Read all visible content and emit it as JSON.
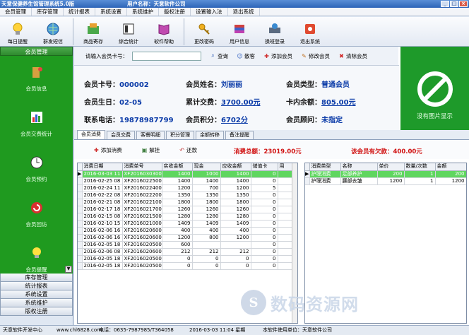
{
  "window": {
    "app_title": "天意保健养生馆管理系统5.0版",
    "user_label": "用户名称：天意软件公司",
    "buttons": [
      "_",
      "□",
      "×"
    ]
  },
  "menu": [
    "会员管理",
    "库存管理",
    "统计报表",
    "系统设置",
    "系统维护",
    "版权注册",
    "设置输入法",
    "退出系统"
  ],
  "toolbar": [
    {
      "label": "每日提醒",
      "icon": "lightbulb-icon"
    },
    {
      "label": "群发短信",
      "icon": "globe-icon"
    },
    {
      "label": "商品寄存",
      "icon": "storage-icon"
    },
    {
      "label": "综合统计",
      "icon": "book-icon"
    },
    {
      "label": "软件帮助",
      "icon": "help-book-icon"
    },
    {
      "label": "更改密码",
      "icon": "key-icon"
    },
    {
      "label": "用户信息",
      "icon": "books-icon"
    },
    {
      "label": "换班登录",
      "icon": "login-icon"
    },
    {
      "label": "退出系统",
      "icon": "exit-icon"
    }
  ],
  "sidebar": {
    "header": "会员管理",
    "items": [
      {
        "label": "会员信息",
        "icon": "member-info-icon"
      },
      {
        "label": "会员交费统计",
        "icon": "chart-icon"
      },
      {
        "label": "会员预约",
        "icon": "clock-icon"
      },
      {
        "label": "会员回访",
        "icon": "refresh-icon"
      },
      {
        "label": "会员提醒",
        "icon": "bulb-icon"
      }
    ],
    "groups": [
      "库存管理",
      "统计报表",
      "系统设置",
      "系统维护",
      "版权注册"
    ]
  },
  "search": {
    "label": "请输入会员卡号：",
    "placeholder": "",
    "buttons": [
      {
        "label": "查询",
        "icon": "search-icon"
      },
      {
        "label": "散客",
        "icon": "guest-icon"
      },
      {
        "label": "添加会员",
        "icon": "add-icon"
      },
      {
        "label": "修改会员",
        "icon": "edit-icon"
      },
      {
        "label": "清除会员",
        "icon": "delete-icon"
      }
    ]
  },
  "member": {
    "card_no_label": "会员卡号：",
    "card_no": "000002",
    "name_label": "会员姓名：",
    "name": "刘丽丽",
    "type_label": "会员类型：",
    "type": "普通会员",
    "birthday_label": "会员生日：",
    "birthday": "02-05",
    "total_spent_label": "累计交费：",
    "total_spent": "3700.00元",
    "balance_label": "卡内余额：",
    "balance": "805.00元",
    "phone_label": "联系电话：",
    "phone": "19878987799",
    "points_label": "会员积分：",
    "points": "6702分",
    "advisor_label": "会员顾问：",
    "advisor": "未指定"
  },
  "photo": {
    "label": "没有图片显示",
    "icon": "no-image-icon"
  },
  "tabs": [
    "会员消费",
    "会员交费",
    "客餐明细",
    "积分管理",
    "余额转移",
    "备注提醒"
  ],
  "actions": [
    {
      "label": "添加消费",
      "icon": "add-consume-icon"
    },
    {
      "label": "解挂",
      "icon": "unhang-icon"
    },
    {
      "label": "还款",
      "icon": "repay-icon"
    }
  ],
  "totals": {
    "consume": "消费总额：23019.00元",
    "debt": "该会员有欠款：400.00元"
  },
  "consume_table": {
    "columns": [
      "消费日期",
      "消费单号",
      "实收金额",
      "现金",
      "应收金额",
      "储值卡",
      "用"
    ],
    "rows": [
      [
        "2016-03-03 11",
        "XF201603030001",
        "1400",
        "1000",
        "1400",
        "0",
        ""
      ],
      [
        "2016-02-25 08",
        "XF201602250001",
        "1400",
        "1400",
        "1400",
        "0",
        ""
      ],
      [
        "2016-02-24 11",
        "XF201602240001",
        "1200",
        "700",
        "1200",
        "5",
        ""
      ],
      [
        "2016-02-22 08",
        "XF201602220002",
        "1350",
        "1350",
        "1350",
        "0",
        ""
      ],
      [
        "2016-02-21 08",
        "XF201602210001",
        "1800",
        "1800",
        "1800",
        "0",
        ""
      ],
      [
        "2016-02-17 18",
        "XF201602170003",
        "1260",
        "1260",
        "1260",
        "0",
        ""
      ],
      [
        "2016-02-15 08",
        "XF201602150002",
        "1280",
        "1280",
        "1280",
        "0",
        ""
      ],
      [
        "2016-02-10 15",
        "XF201602100003",
        "1409",
        "1409",
        "1409",
        "0",
        ""
      ],
      [
        "2016-02-06 16",
        "XF201602060005",
        "400",
        "400",
        "400",
        "0",
        ""
      ],
      [
        "2016-02-06 16",
        "XF201602060004",
        "1200",
        "800",
        "1200",
        "0",
        ""
      ],
      [
        "2016-02-05 18",
        "XF201602050003",
        "600",
        "",
        "",
        "0",
        ""
      ],
      [
        "2016-02-06 08",
        "XF201602060001",
        "212",
        "212",
        "212",
        "0",
        ""
      ],
      [
        "2016-02-05 18",
        "XF201602050009",
        "0",
        "0",
        "0",
        "0",
        ""
      ],
      [
        "2016-02-05 18",
        "XF201602050008",
        "0",
        "0",
        "0",
        "0",
        ""
      ]
    ]
  },
  "detail_table": {
    "columns": [
      "消费类型",
      "名称",
      "单价",
      "数量/次数",
      "金额"
    ],
    "rows": [
      [
        "护理消费",
        "足部养护",
        "200",
        "1",
        "200"
      ],
      [
        "护理消费",
        "腰部去皱",
        "1200",
        "1",
        "1200"
      ]
    ]
  },
  "status": {
    "company": "天意软件开发中心",
    "site": "www.chl6828.com",
    "phone": "电话：0635-7987985/T364058",
    "time": "2016-03-03 11:04  星期",
    "license": "本软件使用单位：天意软件公司"
  },
  "watermark": {
    "text": "数码资源网",
    "logo": "S"
  },
  "colors": {
    "accent_green": "#1f9a1f",
    "highlight_row": "#5fd65f",
    "value_blue": "#0b3ba8",
    "total_red": "#d01010"
  }
}
